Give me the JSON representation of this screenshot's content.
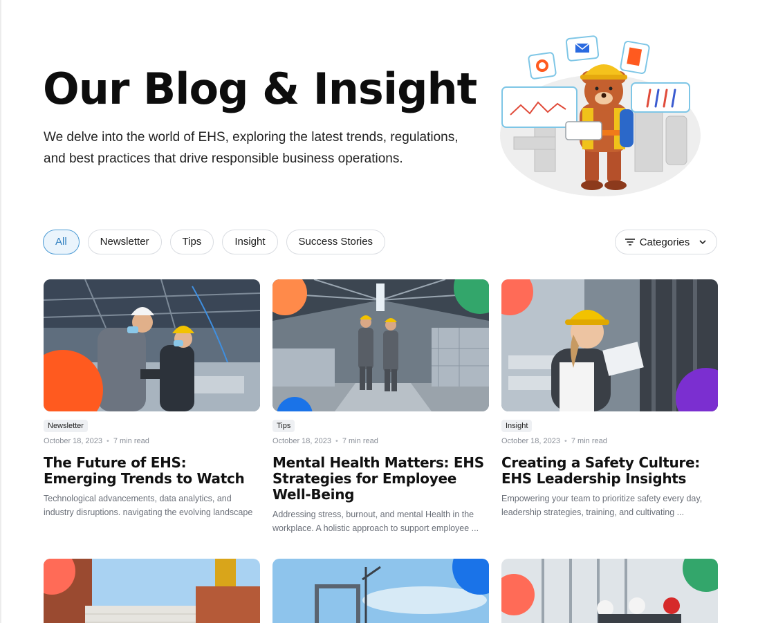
{
  "hero": {
    "title": "Our Blog & Insight",
    "subtitle": "We delve into the world of EHS, exploring the latest trends, regulations, and best practices that drive responsible business operations."
  },
  "filters": {
    "chips": [
      "All",
      "Newsletter",
      "Tips",
      "Insight",
      "Success Stories"
    ],
    "active": "All",
    "categories_label": "Categories"
  },
  "posts": [
    {
      "tag": "Newsletter",
      "date": "October 18, 2023",
      "read_time": "7 min read",
      "title": "The Future of EHS: Emerging Trends to Watch",
      "excerpt": "Technological advancements, data analytics, and industry disruptions. navigating the evolving landscape ..."
    },
    {
      "tag": "Tips",
      "date": "October 18, 2023",
      "read_time": "7 min read",
      "title": "Mental Health Matters: EHS Strategies for Employee Well-Being",
      "excerpt": "Addressing stress, burnout, and mental Health in the workplace. A holistic approach to support employee ..."
    },
    {
      "tag": "Insight",
      "date": "October 18, 2023",
      "read_time": "7 min read",
      "title": "Creating a Safety Culture: EHS Leadership Insights",
      "excerpt": "Empowering your team to prioritize safety every day, leadership strategies, training, and cultivating ..."
    }
  ],
  "colors": {
    "accent": "#2f7fc0",
    "orange": "#ff5a1f",
    "coral": "#ff6b57",
    "green": "#33a66b",
    "blue": "#1a73e8",
    "purple": "#7b2fd0"
  }
}
